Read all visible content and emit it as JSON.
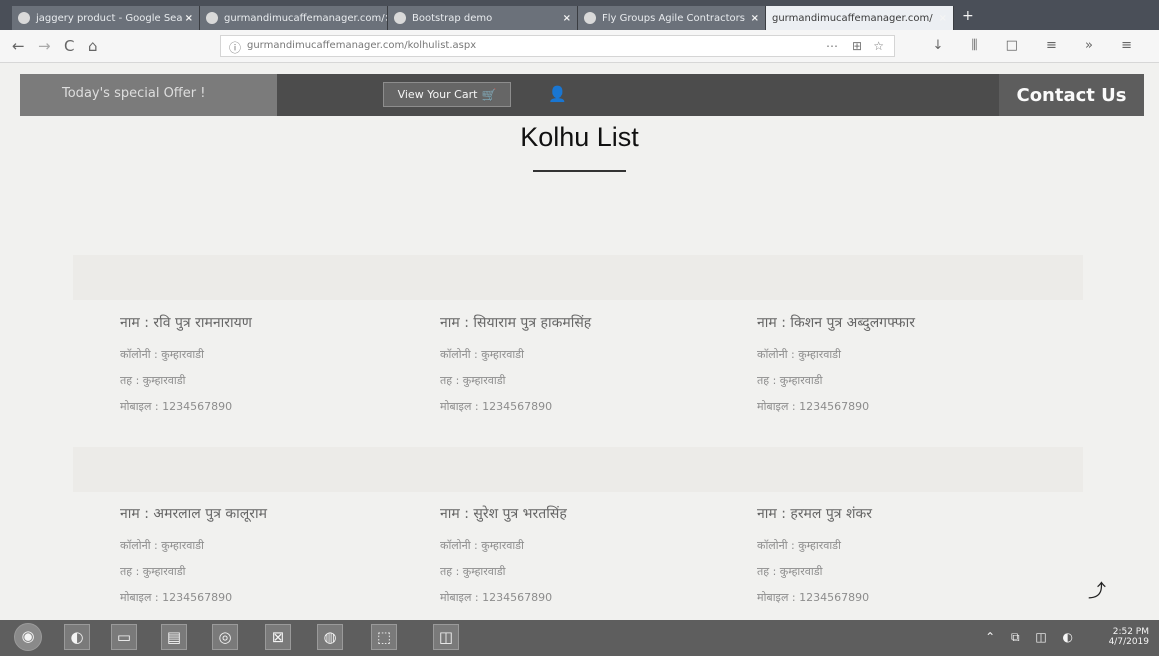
{
  "browser": {
    "tabs": [
      {
        "label": "jaggery product - Google Sea"
      },
      {
        "label": "gurmandimucaffemanager.com/"
      },
      {
        "label": "Bootstrap demo"
      },
      {
        "label": "Fly Groups Agile Contractors"
      },
      {
        "label": "gurmandimucaffemanager.com/"
      }
    ],
    "new_tab": "+",
    "back": "←",
    "forward": "→",
    "reload": "C",
    "home": "⌂",
    "url": "gurmandimucaffemanager.com/kolhulist.aspx",
    "menu_dots": "⋯",
    "pocket": "⊞",
    "bookmark": "☆",
    "toolbar_icons": "↓ ⫼ □ ≡ » ≡"
  },
  "site": {
    "offer_label": "Today's special Offer !",
    "cart_label": "View Your Cart",
    "cart_icon": "🛒",
    "user_icon": "👤",
    "contact_label": "Contact Us"
  },
  "page": {
    "title": "Kolhu List"
  },
  "cards": [
    {
      "name": "नाम : रवि पुत्र रामनारायण",
      "line1": "कॉलोनी : कुम्हारवाडी",
      "line2": "तह : कुम्हारवाडी",
      "line3": "मोबाइल : 1234567890"
    },
    {
      "name": "नाम : सियाराम पुत्र हाकमसिंह",
      "line1": "कॉलोनी : कुम्हारवाडी",
      "line2": "तह : कुम्हारवाडी",
      "line3": "मोबाइल : 1234567890"
    },
    {
      "name": "नाम : किशन पुत्र अब्दुलगफ्फार",
      "line1": "कॉलोनी : कुम्हारवाडी",
      "line2": "तह : कुम्हारवाडी",
      "line3": "मोबाइल : 1234567890"
    },
    {
      "name": "नाम : अमरलाल पुत्र कालूराम",
      "line1": "कॉलोनी : कुम्हारवाडी",
      "line2": "तह : कुम्हारवाडी",
      "line3": "मोबाइल : 1234567890"
    },
    {
      "name": "नाम : सुरेश पुत्र भरतसिंह",
      "line1": "कॉलोनी : कुम्हारवाडी",
      "line2": "तह : कुम्हारवाडी",
      "line3": "मोबाइल : 1234567890"
    },
    {
      "name": "नाम : हरमल पुत्र शंकर",
      "line1": "कॉलोनी : कुम्हारवाडी",
      "line2": "तह : कुम्हारवाडी",
      "line3": "मोबाइल : 1234567890"
    }
  ],
  "share_icon": "⤴",
  "taskbar": {
    "start": "◉",
    "icons": [
      "◐",
      "▭",
      "▤",
      "◎",
      "⊠",
      "◍",
      "⬚",
      "◫"
    ],
    "tray": "⌃ ⧉ ◫ ◐",
    "clock_time": "2:52 PM",
    "clock_date": "4/7/2019"
  }
}
